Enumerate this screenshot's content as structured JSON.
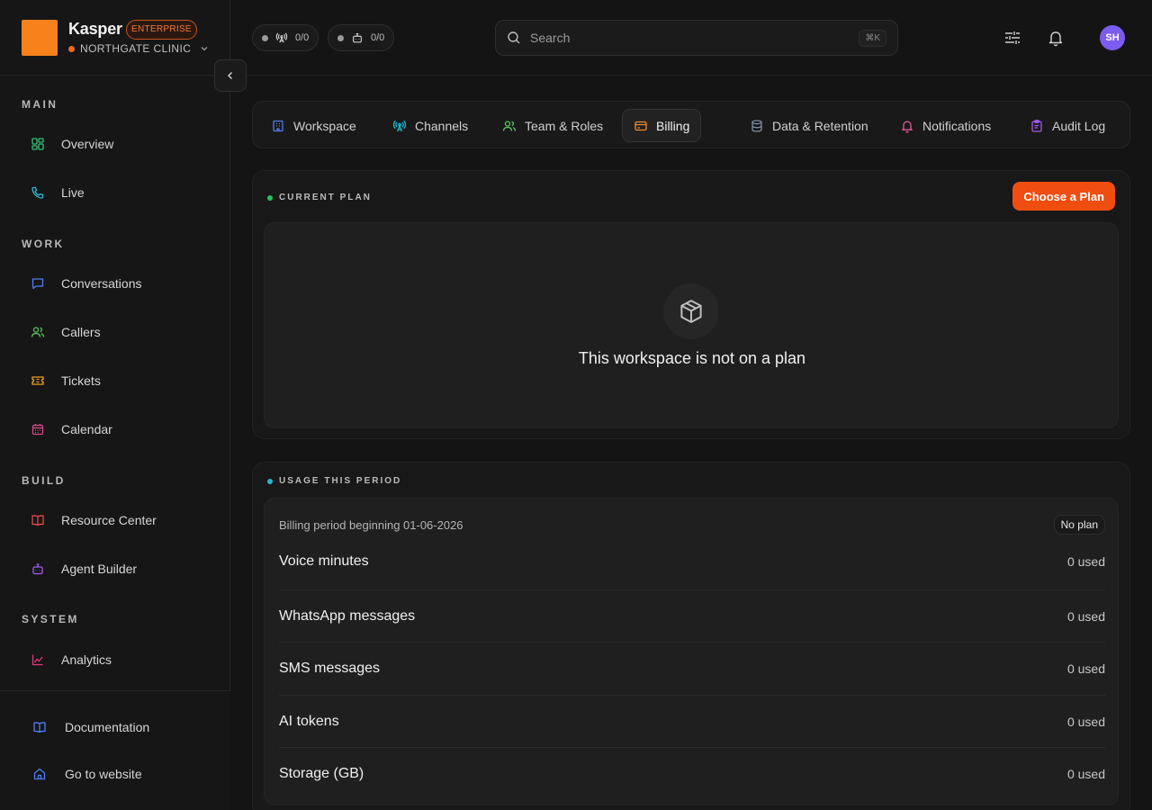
{
  "brand": {
    "name": "Kasper",
    "badge": "ENTERPRISE",
    "org": "NORTHGATE CLINIC"
  },
  "sidebar": {
    "sections": [
      {
        "label": "MAIN",
        "items": [
          {
            "label": "Overview",
            "icon": "grid-icon"
          },
          {
            "label": "Live",
            "icon": "phone-icon"
          }
        ]
      },
      {
        "label": "WORK",
        "items": [
          {
            "label": "Conversations",
            "icon": "chat-icon"
          },
          {
            "label": "Callers",
            "icon": "users-icon"
          },
          {
            "label": "Tickets",
            "icon": "ticket-icon"
          },
          {
            "label": "Calendar",
            "icon": "calendar-icon"
          }
        ]
      },
      {
        "label": "BUILD",
        "items": [
          {
            "label": "Resource Center",
            "icon": "book-icon"
          },
          {
            "label": "Agent Builder",
            "icon": "bot-icon"
          }
        ]
      },
      {
        "label": "SYSTEM",
        "items": [
          {
            "label": "Analytics",
            "icon": "chart-icon"
          }
        ]
      }
    ],
    "footer": [
      {
        "label": "Documentation",
        "icon": "book-open-icon"
      },
      {
        "label": "Go to website",
        "icon": "home-icon"
      }
    ]
  },
  "topbar": {
    "channels_count": "0/0",
    "agents_count": "0/0",
    "search_placeholder": "Search",
    "search_shortcut": "⌘K",
    "avatar_initials": "SH"
  },
  "tabs": [
    {
      "label": "Workspace",
      "icon": "building-icon",
      "color": "#4f7df0"
    },
    {
      "label": "Channels",
      "icon": "antenna-icon",
      "color": "#22b8d6"
    },
    {
      "label": "Team & Roles",
      "icon": "users-icon",
      "color": "#5cc55a"
    },
    {
      "label": "Billing",
      "icon": "card-icon",
      "color": "#f08a2c",
      "active": true
    },
    {
      "label": "Data & Retention",
      "icon": "database-icon",
      "color": "#7a8fa8"
    },
    {
      "label": "Notifications",
      "icon": "bell-icon",
      "color": "#e05a9a"
    },
    {
      "label": "Audit Log",
      "icon": "clipboard-icon",
      "color": "#a25af0"
    }
  ],
  "current_plan": {
    "heading": "CURRENT PLAN",
    "button": "Choose a Plan",
    "empty_text": "This workspace is not on a plan"
  },
  "usage": {
    "heading": "USAGE THIS PERIOD",
    "period_label": "Billing period beginning 01-06-2026",
    "plan_badge": "No plan",
    "rows": [
      {
        "name": "Voice minutes",
        "value": "0 used"
      },
      {
        "name": "WhatsApp messages",
        "value": "0 used"
      },
      {
        "name": "SMS messages",
        "value": "0 used"
      },
      {
        "name": "AI tokens",
        "value": "0 used"
      },
      {
        "name": "Storage (GB)",
        "value": "0 used"
      }
    ]
  },
  "colors": {
    "accent": "#f04d10",
    "logo": "#f7821b",
    "plan_dot": "#22c55e",
    "usage_dot": "#22b8d6"
  }
}
